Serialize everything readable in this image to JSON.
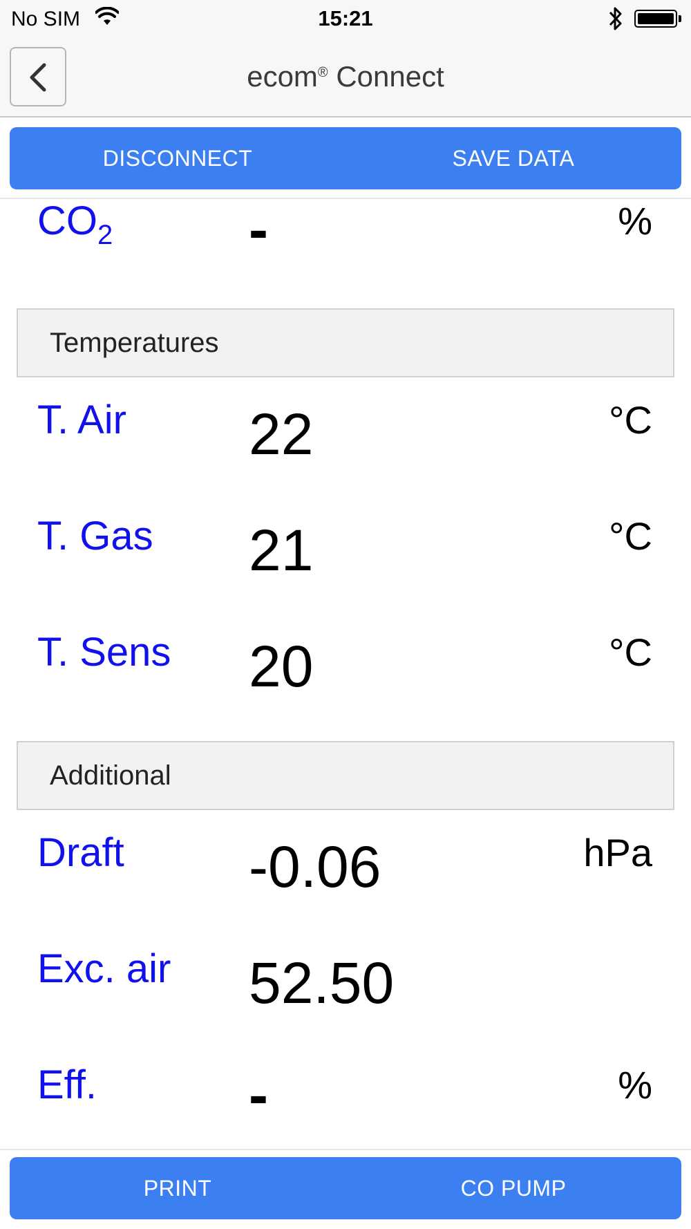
{
  "status_bar": {
    "carrier": "No SIM",
    "time": "15:21",
    "icons": [
      "wifi-icon",
      "bluetooth-icon",
      "battery-icon"
    ]
  },
  "nav": {
    "title_main": "ecom",
    "title_reg": "®",
    "title_rest": " Connect",
    "back_icon": "chevron-left-icon"
  },
  "top_actions": {
    "disconnect": "DISCONNECT",
    "save_data": "SAVE DATA"
  },
  "co2_row": {
    "label_main": "CO",
    "label_sub": "2",
    "value": "-",
    "unit": "%"
  },
  "sections": [
    {
      "title": "Temperatures",
      "rows": [
        {
          "label": "T. Air",
          "value": "22",
          "unit": "°C"
        },
        {
          "label": "T. Gas",
          "value": "21",
          "unit": "°C"
        },
        {
          "label": "T. Sens",
          "value": "20",
          "unit": "°C"
        }
      ]
    },
    {
      "title": "Additional",
      "rows": [
        {
          "label": "Draft",
          "value": "-0.06",
          "unit": "hPa"
        },
        {
          "label": "Exc. air",
          "value": "52.50",
          "unit": ""
        },
        {
          "label": "Eff.",
          "value": "-",
          "unit": "%"
        }
      ]
    }
  ],
  "bottom_actions": {
    "print": "PRINT",
    "co_pump": "CO PUMP"
  },
  "colors": {
    "accent": "#3b7ff0",
    "label_blue": "#1111ee",
    "nav_bg": "#f7f7f7",
    "section_bg": "#f2f2f2"
  }
}
